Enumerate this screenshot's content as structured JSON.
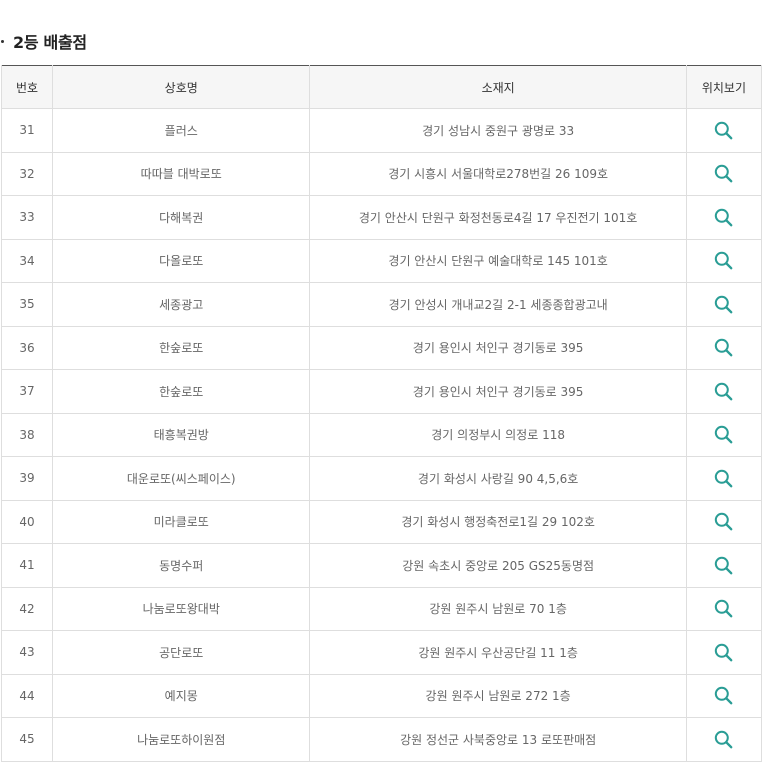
{
  "section": {
    "title": "2등 배출점"
  },
  "table": {
    "headers": {
      "number": "번호",
      "store_name": "상호명",
      "address": "소재지",
      "location": "위치보기"
    },
    "rows": [
      {
        "number": "31",
        "store_name": "플러스",
        "address": "경기 성남시 중원구 광명로 33"
      },
      {
        "number": "32",
        "store_name": "따따블 대박로또",
        "address": "경기 시흥시 서울대학로278번길 26 109호"
      },
      {
        "number": "33",
        "store_name": "다해복권",
        "address": "경기 안산시 단원구 화정천동로4길 17 우진전기 101호"
      },
      {
        "number": "34",
        "store_name": "다올로또",
        "address": "경기 안산시 단원구 예술대학로 145 101호"
      },
      {
        "number": "35",
        "store_name": "세종광고",
        "address": "경기 안성시 개내교2길 2-1 세종종합광고내"
      },
      {
        "number": "36",
        "store_name": "한숲로또",
        "address": "경기 용인시 처인구 경기동로 395"
      },
      {
        "number": "37",
        "store_name": "한숲로또",
        "address": "경기 용인시 처인구 경기동로 395"
      },
      {
        "number": "38",
        "store_name": "태흥복권방",
        "address": "경기 의정부시 의정로 118"
      },
      {
        "number": "39",
        "store_name": "대운로또(씨스페이스)",
        "address": "경기 화성시 사랑길 90 4,5,6호"
      },
      {
        "number": "40",
        "store_name": "미라클로또",
        "address": "경기 화성시 행정축전로1길 29 102호"
      },
      {
        "number": "41",
        "store_name": "동명수퍼",
        "address": "강원 속초시 중앙로 205 GS25동명점"
      },
      {
        "number": "42",
        "store_name": "나눔로또왕대박",
        "address": "강원 원주시 남원로 70 1층"
      },
      {
        "number": "43",
        "store_name": "공단로또",
        "address": "강원 원주시 우산공단길 11 1층"
      },
      {
        "number": "44",
        "store_name": "예지몽",
        "address": "강원 원주시 남원로 272 1층"
      },
      {
        "number": "45",
        "store_name": "나눔로또하이원점",
        "address": "강원 정선군 사북중앙로 13 로또판매점"
      }
    ],
    "map_icon": "search-icon"
  },
  "colors": {
    "accent_icon": "#2a9d95",
    "header_bg": "#f6f6f6",
    "border": "#dedede",
    "top_border": "#555555"
  }
}
